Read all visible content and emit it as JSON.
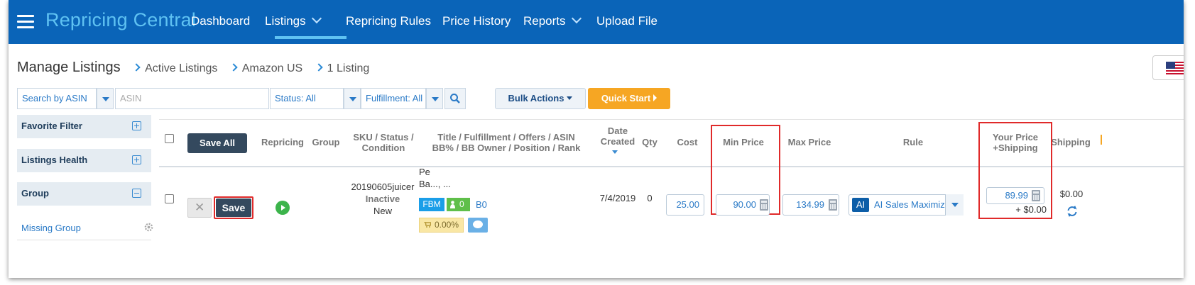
{
  "app": {
    "brand_left": "Repricing",
    "brand_right": "Central",
    "nav": [
      "Dashboard",
      "Listings",
      "Repricing Rules",
      "Price History",
      "Reports",
      "Upload File"
    ]
  },
  "breadcrumb": {
    "title": "Manage Listings",
    "items": [
      "Active Listings",
      "Amazon US",
      "1 Listing"
    ]
  },
  "filters": {
    "search_by": "Search by ASIN",
    "asin_placeholder": "ASIN",
    "status": "Status: All",
    "fulfillment": "Fulfillment: All",
    "bulk_actions": "Bulk Actions",
    "quick_start": "Quick Start"
  },
  "sidebar": {
    "favorite_filter": "Favorite Filter",
    "listings_health": "Listings Health",
    "group": "Group",
    "missing_group": "Missing Group"
  },
  "table": {
    "save_all": "Save All",
    "headers": {
      "repricing": "Repricing",
      "group": "Group",
      "sku_1": "SKU / Status /",
      "sku_2": "Condition",
      "title_1": "Title / Fulfillment / Offers / ASIN",
      "title_2": "BB% / BB Owner / Position / Rank",
      "date_1": "Date",
      "date_2": "Created",
      "qty": "Qty",
      "cost": "Cost",
      "min_price": "Min Price",
      "max_price": "Max Price",
      "rule": "Rule",
      "your_price_1": "Your Price",
      "your_price_2": "+Shipping",
      "shipping": "Shipping"
    },
    "row": {
      "save": "Save",
      "close_symbol": "✕",
      "sku": "20190605juicer",
      "status": "Inactive",
      "condition": "New",
      "title_line1": "Pe",
      "title_line2": "Ba..., ...",
      "fulfillment": "FBM",
      "offers": "0",
      "asin": "B0",
      "bb_percent": "0.00%",
      "date_created": "7/4/2019",
      "qty": "0",
      "cost": "25.00",
      "min_price": "90.00",
      "max_price": "134.99",
      "rule_badge": "AI",
      "rule_name": "AI Sales Maximizer",
      "your_price": "89.99",
      "your_price_shipping": "+ $0.00",
      "shipping": "$0.00"
    }
  },
  "colors": {
    "nav_bg": "#0a64b8",
    "brand": "#5fc2f2",
    "highlight": "#e02a2a",
    "quick_start": "#f6a623",
    "save_button": "#34495e"
  }
}
